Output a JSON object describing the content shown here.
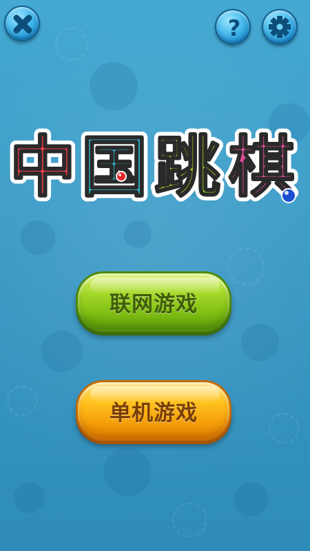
{
  "title": {
    "chars": [
      "中",
      "国",
      "跳",
      "棋"
    ],
    "colors": [
      "#ee3f4b",
      "#2cc3d9",
      "#9fd323",
      "#e34c9d"
    ]
  },
  "top_bar": {
    "close_icon": "close-icon",
    "help_icon": "question-icon",
    "settings_icon": "gear-icon",
    "help_glyph": "?"
  },
  "menu": {
    "online_label": "联网游戏",
    "single_label": "单机游戏",
    "online_color": "#8cc81c",
    "single_color": "#f7a812"
  },
  "colors": {
    "background": "#3a9bc6",
    "icon_button": "#2f9fdb"
  }
}
